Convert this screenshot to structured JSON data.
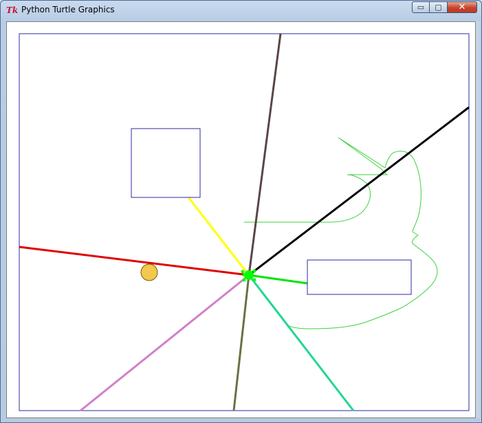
{
  "window": {
    "title": "Python Turtle Graphics",
    "app_icon_text": "Tk",
    "controls": {
      "minimize": "▭",
      "maximize": "▢",
      "close": "✕"
    }
  },
  "canvas": {
    "background": "#ffffff",
    "border_color": "#2929a3",
    "turtle_color": "#00ff00",
    "emoji_face": "😜",
    "ray_colors": {
      "red": "#e00000",
      "brown": "#5a4646",
      "black": "#000000",
      "green": "#00e600",
      "teal": "#20d890",
      "olive": "#6e6e46",
      "pink": "#d080c8",
      "yellow": "#ffff00"
    },
    "squiggle_color": "#3cd23c",
    "box_color": "#2929a3"
  }
}
